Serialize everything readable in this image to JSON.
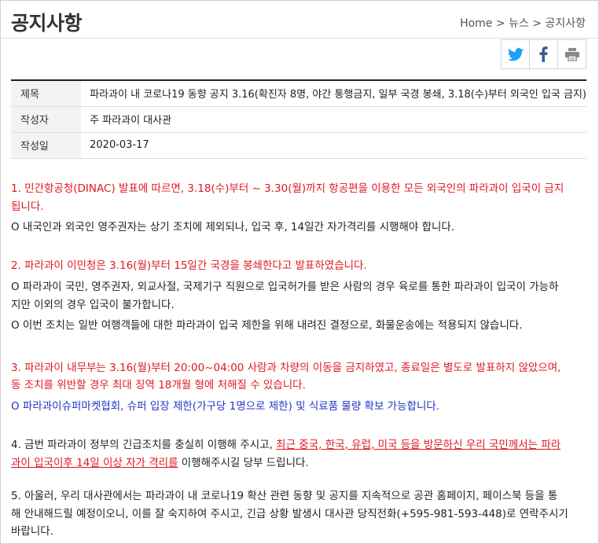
{
  "header": {
    "title": "공지사항",
    "breadcrumb": {
      "home": "Home",
      "sep": ">",
      "news": "뉴스",
      "current": "공지사항"
    }
  },
  "share": {
    "twitter_icon": "twitter-icon",
    "facebook_icon": "facebook-icon",
    "print_icon": "print-icon"
  },
  "info": {
    "rows": [
      {
        "label": "제목",
        "value": "파라과이 내 코로나19 동향 공지 3.16(확진자 8명, 야간 통행금지, 일부 국경 봉쇄, 3.18(수)부터 외국인 입국 금지)"
      },
      {
        "label": "작성자",
        "value": "주 파라과이 대사관"
      },
      {
        "label": "작성일",
        "value": "2020-03-17"
      }
    ]
  },
  "body": {
    "s1_l1": "1. 민간항공청(DINAC) 발표에 따르면, 3.18(수)부터 ~ 3.30(월)까지 항공편을 이용한 모든 외국인의 파라과이 입국이 금지",
    "s1_l2": "됩니다.",
    "s1_l3": "O 내국인과 외국인 영주권자는 상기 조치에 제외되나, 입국 후, 14일간 자가격리를 시행해야 합니다.",
    "s2_l1": "2. 파라과이 이민청은 3.16(월)부터 15일간 국경을 봉쇄한다고 발표하였습니다.",
    "s2_l2": "O 파라과이 국민, 영주권자, 외교사절, 국제기구 직원으로 입국허가를 받은 사람의 경우 육로를 통한 파라과이 입국이 가능하",
    "s2_l3": "지만 이외의 경우 입국이 불가합니다.",
    "s2_l4": "O 이번 조치는 일반 여행객들에 대한 파라과이 입국 제한을 위해 내려진 결정으로, 화물운송에는 적용되지 않습니다.",
    "s3_l1": "3. 파라과이 내무부는 3.16(월)부터 20:00~04:00 사람과 차량의 이동을 금지하였고, 종료일은 별도로 발표하지 않았으며,",
    "s3_l2": "동 조치를 위반할 경우 최대 징역 18개월 형에 처해질 수 있습니다.",
    "s3_l3": "O 파라과이슈퍼마켓협회, 슈퍼 입장 제한(가구당 1명으로 제한) 및 식료품 물량 확보 가능합니다.",
    "s4_a": "4. 금번 파라과이 정부의 긴급조치를 충실히 이행해 주시고, ",
    "s4_b": "최근 중국, 한국, 유럽, 미국 등을 방문하신 우리 국민께서는 파라",
    "s4_c": "과이 입국이후 14일 이상 자가 격리를",
    "s4_d": " 이행해주시길 당부 드립니다.",
    "s5_l1": "5. 아울러, 우리 대사관에서는 파라과이 내 코로나19 확산 관련 동향 및 공지를 지속적으로 공관 홈페이지, 페이스북 등을 통",
    "s5_l2": "해 안내해드릴 예정이오니, 이를 잘 숙지하여 주시고, 긴급 상황 발생시 대사관 당직전화(+595-981-593-448)로 연락주시기",
    "s5_l3": "바랍니다."
  },
  "colors": {
    "red": "#e0191f",
    "blue": "#1f36c4",
    "twitter": "#1da1f2",
    "facebook": "#3b5998",
    "print": "#888888"
  }
}
